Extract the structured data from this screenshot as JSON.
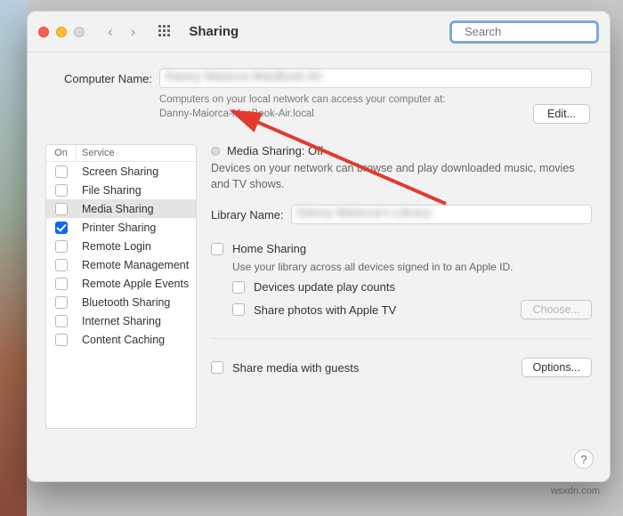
{
  "header": {
    "title": "Sharing",
    "search_placeholder": "Search"
  },
  "computer": {
    "label": "Computer Name:",
    "value": "Danny Maiorca MacBook Air",
    "note_line1": "Computers on your local network can access your computer at:",
    "note_line2": "Danny-Maiorca-MacBook-Air.local",
    "edit_button": "Edit..."
  },
  "services": {
    "col_on": "On",
    "col_service": "Service",
    "items": [
      {
        "label": "Screen Sharing",
        "checked": false
      },
      {
        "label": "File Sharing",
        "checked": false
      },
      {
        "label": "Media Sharing",
        "checked": false,
        "selected": true
      },
      {
        "label": "Printer Sharing",
        "checked": true
      },
      {
        "label": "Remote Login",
        "checked": false
      },
      {
        "label": "Remote Management",
        "checked": false
      },
      {
        "label": "Remote Apple Events",
        "checked": false
      },
      {
        "label": "Bluetooth Sharing",
        "checked": false
      },
      {
        "label": "Internet Sharing",
        "checked": false
      },
      {
        "label": "Content Caching",
        "checked": false
      }
    ]
  },
  "detail": {
    "status_label": "Media Sharing: Off",
    "description": "Devices on your network can browse and play downloaded music, movies and TV shows.",
    "library_label": "Library Name:",
    "library_value": "Danny Maiorca's Library",
    "home_sharing": "Home Sharing",
    "home_sharing_hint": "Use your library across all devices signed in to an Apple ID.",
    "devices_update": "Devices update play counts",
    "share_photos": "Share photos with Apple TV",
    "choose_button": "Choose...",
    "share_guests": "Share media with guests",
    "options_button": "Options..."
  },
  "watermark": "wsxdn.com"
}
